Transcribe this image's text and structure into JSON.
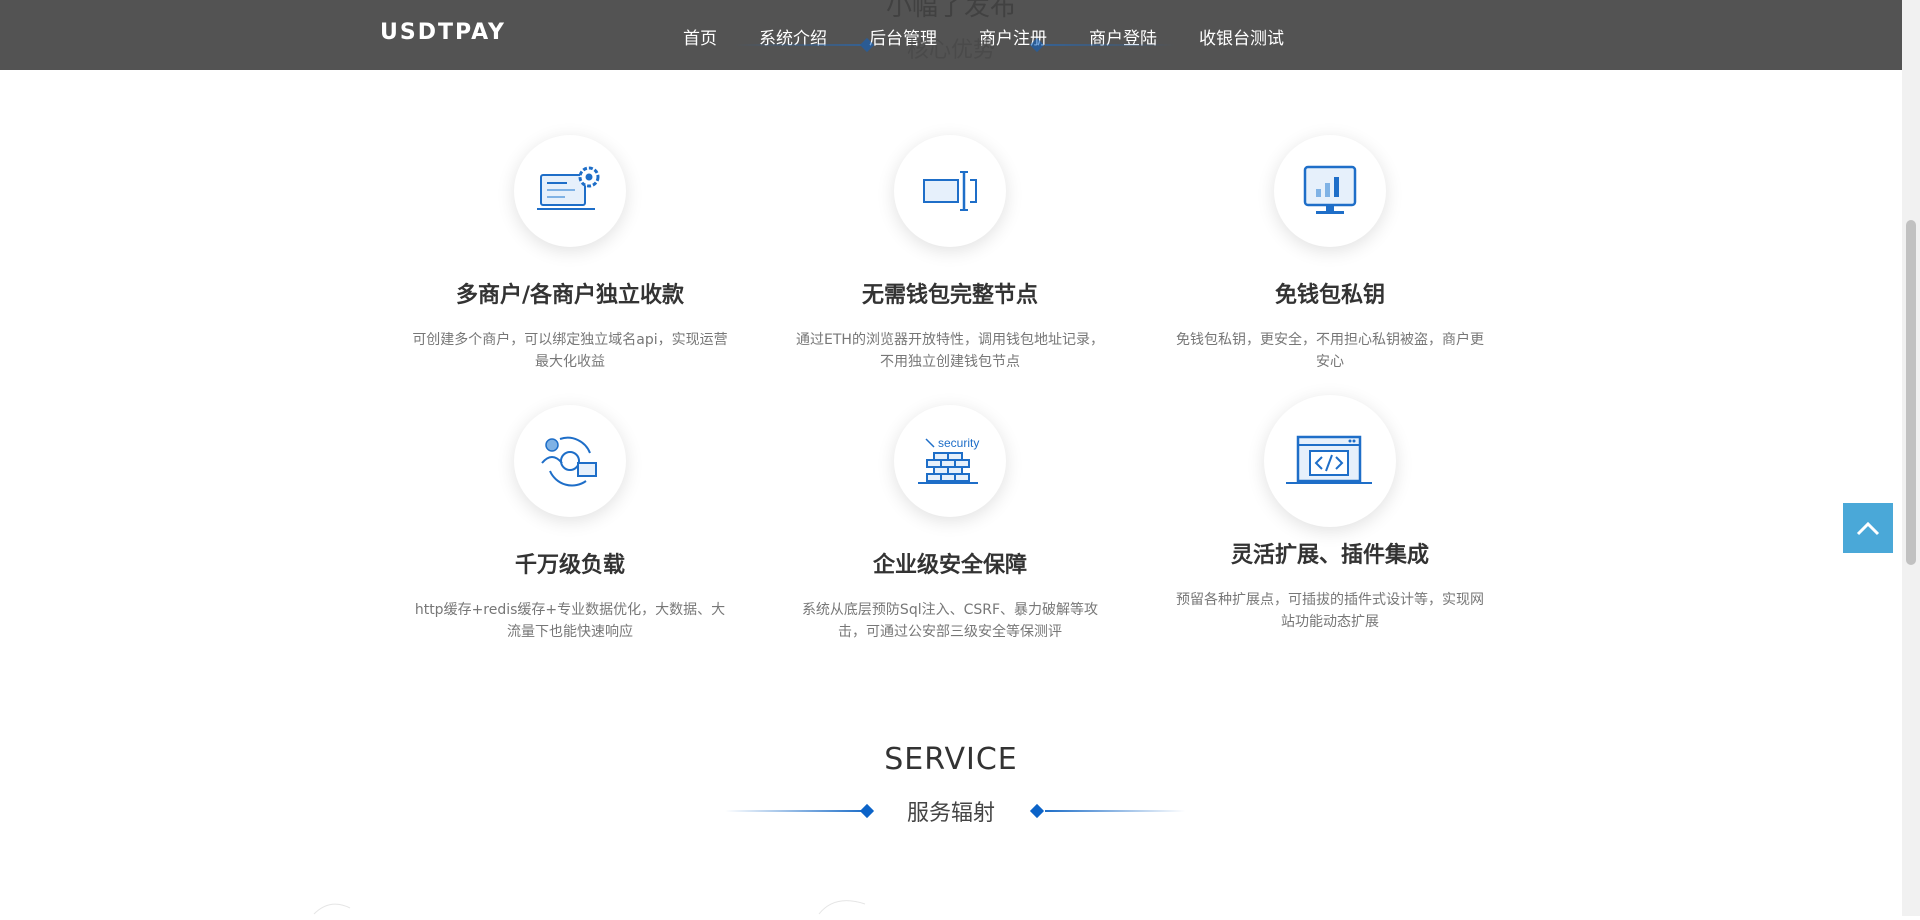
{
  "brand": "USDTPAY",
  "nav": [
    "首页",
    "系统介绍",
    "后台管理",
    "商户注册",
    "商户登陆",
    "收银台测试"
  ],
  "prev_section": {
    "title": "小幅了发布",
    "subtitle": "核心优势"
  },
  "features": [
    {
      "icon": "settings-document-icon",
      "title": "多商户/各商户独立收款",
      "desc": "可创建多个商户，可以绑定独立域名api，实现运营最大化收益"
    },
    {
      "icon": "wallet-node-icon",
      "title": "无需钱包完整节点",
      "desc": "通过ETH的浏览器开放特性，调用钱包地址记录，不用独立创建钱包节点"
    },
    {
      "icon": "monitor-chart-icon",
      "title": "免钱包私钥",
      "desc": "免钱包私钥，更安全，不用担心私钥被盗，商户更安心"
    },
    {
      "icon": "load-users-icon",
      "title": "千万级负载",
      "desc": "http缓存+redis缓存+专业数据优化，大数据、大流量下也能快速响应"
    },
    {
      "icon": "security-wall-icon",
      "title": "企业级安全保障",
      "desc": "系统从底层预防Sql注入、CSRF、暴力破解等攻击，可通过公安部三级安全等保测评"
    },
    {
      "icon": "code-window-icon",
      "title": "灵活扩展、插件集成",
      "desc": "预留各种扩展点，可插拔的插件式设计等，实现网站功能动态扩展"
    }
  ],
  "service": {
    "title": "SERVICE",
    "subtitle": "服务辐射"
  },
  "colors": {
    "header": "#535353",
    "accent": "#1e6ec8",
    "to_top": "#4aa8d8"
  },
  "security_label": "security"
}
